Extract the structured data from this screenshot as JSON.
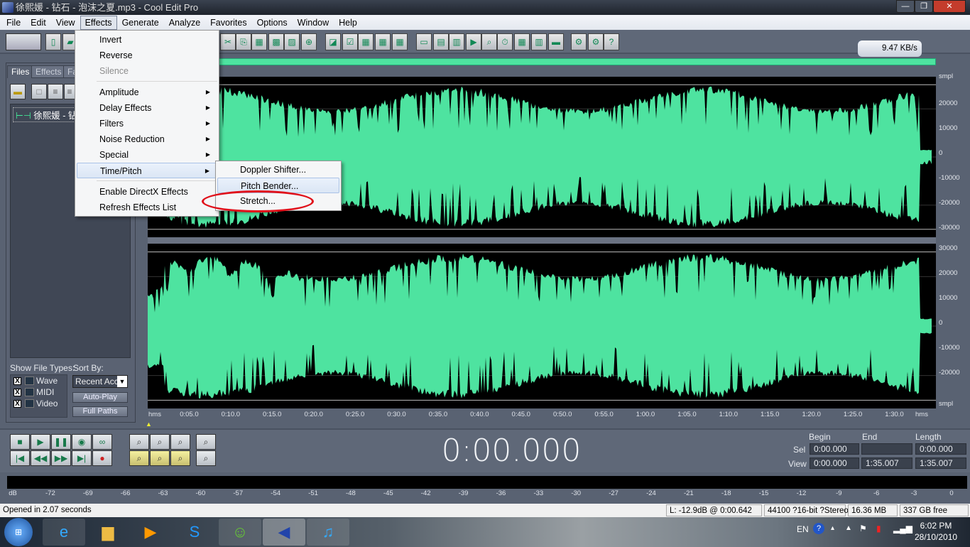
{
  "title": "徐熙媛 - 钻石 - 泡沫之夏.mp3 - Cool Edit Pro",
  "menubar": [
    "File",
    "Edit",
    "View",
    "Effects",
    "Generate",
    "Analyze",
    "Favorites",
    "Options",
    "Window",
    "Help"
  ],
  "effects_menu": {
    "items": [
      {
        "label": "Invert",
        "disabled": false,
        "submenu": false
      },
      {
        "label": "Reverse",
        "disabled": false,
        "submenu": false
      },
      {
        "label": "Silence",
        "disabled": true,
        "submenu": false
      },
      {
        "sep": true
      },
      {
        "label": "Amplitude",
        "submenu": true
      },
      {
        "label": "Delay Effects",
        "submenu": true
      },
      {
        "label": "Filters",
        "submenu": true
      },
      {
        "label": "Noise Reduction",
        "submenu": true
      },
      {
        "label": "Special",
        "submenu": true
      },
      {
        "label": "Time/Pitch",
        "submenu": true,
        "highlighted": true
      },
      {
        "sep": true
      },
      {
        "label": "Enable DirectX Effects",
        "submenu": false
      },
      {
        "label": "Refresh Effects List",
        "submenu": false
      }
    ]
  },
  "time_pitch_submenu": [
    "Doppler Shifter...",
    "Pitch Bender...",
    "Stretch..."
  ],
  "left_panel": {
    "tabs": [
      "Files",
      "Effects",
      "Fa"
    ],
    "file": "徐熙媛 - 钻石 - 泡沫之夏.mp3",
    "show_file_types": "Show File Types:",
    "types": [
      {
        "label": "Wave",
        "checked": true
      },
      {
        "label": "MIDI",
        "checked": true
      },
      {
        "label": "Video",
        "checked": true
      }
    ],
    "sort_by": "Sort By:",
    "sort_value": "Recent Acc",
    "auto_play": "Auto-Play",
    "full_paths": "Full Paths"
  },
  "speed_widget": "9.47 KB/s",
  "amp_axis_top": [
    "smpl",
    "20000",
    "10000",
    "0",
    "-10000",
    "-20000",
    "-30000"
  ],
  "amp_axis_bottom": [
    "30000",
    "20000",
    "10000",
    "0",
    "-10000",
    "-20000",
    "smpl"
  ],
  "time_ruler": [
    "hms",
    "0:05.0",
    "0:10.0",
    "0:15.0",
    "0:20.0",
    "0:25.0",
    "0:30.0",
    "0:35.0",
    "0:40.0",
    "0:45.0",
    "0:50.0",
    "0:55.0",
    "1:00.0",
    "1:05.0",
    "1:10.0",
    "1:15.0",
    "1:20.0",
    "1:25.0",
    "1:30.0",
    "hms"
  ],
  "clock": "0:00.000",
  "selection": {
    "headers": [
      "Begin",
      "End",
      "Length"
    ],
    "sel_label": "Sel",
    "view_label": "View",
    "sel": [
      "0:00.000",
      "",
      "0:00.000"
    ],
    "view": [
      "0:00.000",
      "1:35.007",
      "1:35.007"
    ]
  },
  "meter_scale": [
    "dB",
    "-72",
    "-69",
    "-66",
    "-63",
    "-60",
    "-57",
    "-54",
    "-51",
    "-48",
    "-45",
    "-42",
    "-39",
    "-36",
    "-33",
    "-30",
    "-27",
    "-24",
    "-21",
    "-18",
    "-15",
    "-12",
    "-9",
    "-6",
    "-3",
    "0"
  ],
  "status": {
    "message": "Opened in 2.07 seconds",
    "level": "L: -12.9dB @  0:00.642",
    "format": "44100 ?16-bit ?Stereo",
    "size": "16.36 MB",
    "free": "337 GB free"
  },
  "tray": {
    "lang": "EN",
    "time": "6:02 PM",
    "date": "28/10/2010"
  },
  "colors": {
    "waveform": "#4ee3a0",
    "highlight_ellipse": "#e0101a"
  }
}
